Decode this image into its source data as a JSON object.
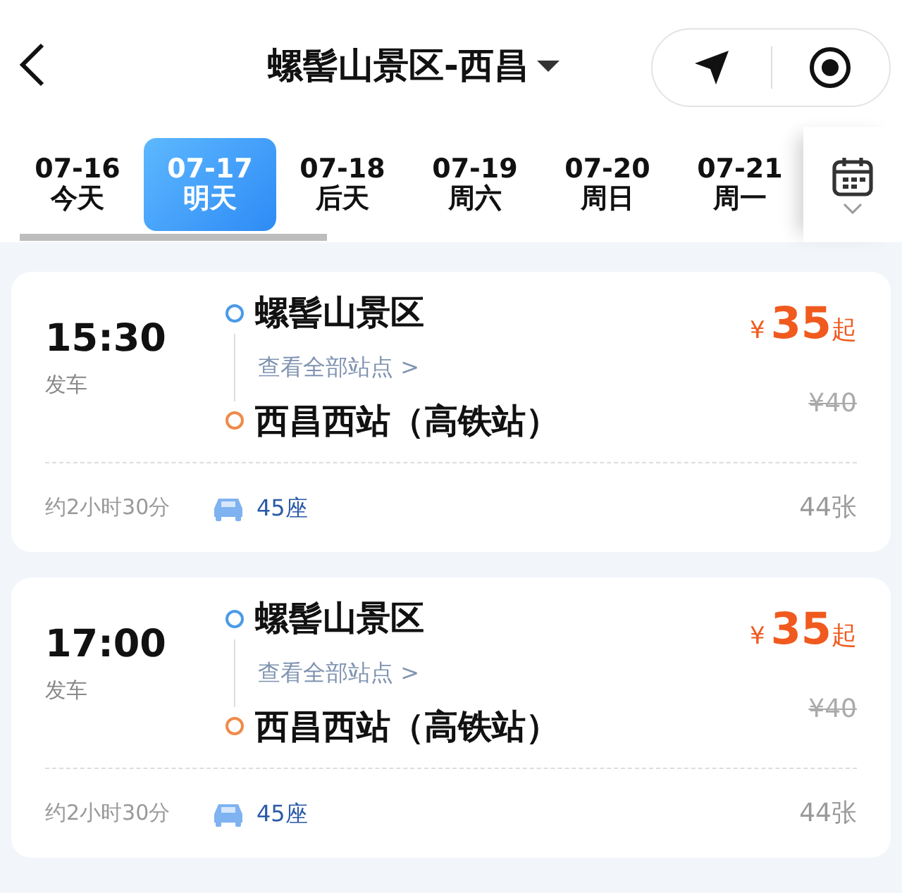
{
  "header": {
    "title": "螺髻山景区-西昌"
  },
  "dates": [
    {
      "date": "07-16",
      "label": "今天",
      "selected": false
    },
    {
      "date": "07-17",
      "label": "明天",
      "selected": true
    },
    {
      "date": "07-18",
      "label": "后天",
      "selected": false
    },
    {
      "date": "07-19",
      "label": "周六",
      "selected": false
    },
    {
      "date": "07-20",
      "label": "周日",
      "selected": false
    },
    {
      "date": "07-21",
      "label": "周一",
      "selected": false
    }
  ],
  "trips": [
    {
      "time": "15:30",
      "time_label": "发车",
      "from": "螺髻山景区",
      "stops_link": "查看全部站点 >",
      "to": "西昌西站（高铁站）",
      "currency": "¥",
      "price": "35",
      "price_suffix": "起",
      "original_price": "¥40",
      "duration": "约2小时30分",
      "seats": "45座",
      "tickets": "44张"
    },
    {
      "time": "17:00",
      "time_label": "发车",
      "from": "螺髻山景区",
      "stops_link": "查看全部站点 >",
      "to": "西昌西站（高铁站）",
      "currency": "¥",
      "price": "35",
      "price_suffix": "起",
      "original_price": "¥40",
      "duration": "约2小时30分",
      "seats": "45座",
      "tickets": "44张"
    }
  ]
}
